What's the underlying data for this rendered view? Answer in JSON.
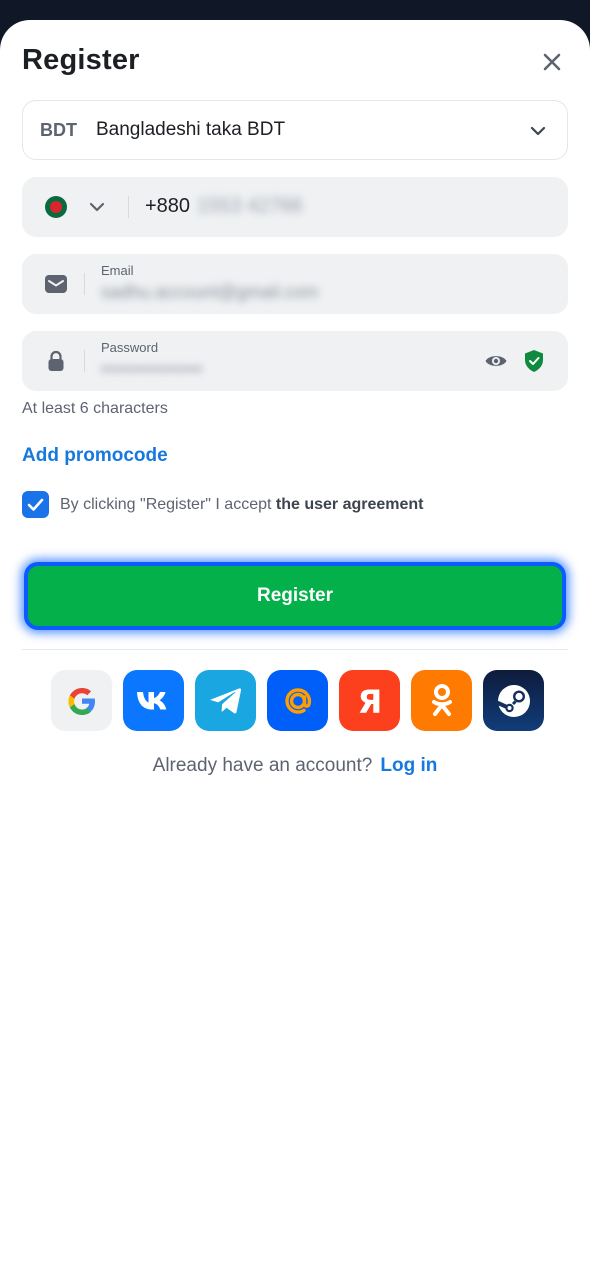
{
  "header": {
    "title": "Register"
  },
  "currency": {
    "code": "BDT",
    "name": "Bangladeshi taka BDT"
  },
  "phone": {
    "prefix": "+880",
    "number": "1553 42766"
  },
  "email": {
    "label": "Email",
    "value": "sadhu.account@gmail.com"
  },
  "password": {
    "label": "Password",
    "value": "••••••••••••••"
  },
  "hint": "At least 6 characters",
  "promo": "Add promocode",
  "agreement": {
    "checked": true,
    "text": "By clicking \"Register\" I accept ",
    "link": "the user agreement"
  },
  "register_button": "Register",
  "socials": [
    "google-icon",
    "vk-icon",
    "telegram-icon",
    "mail-ru-icon",
    "yandex-icon",
    "odnoklassniki-icon",
    "steam-icon"
  ],
  "login": {
    "text": "Already have an account?",
    "link": "Log in"
  },
  "colors": {
    "primary": "#04b04a",
    "link": "#1778e0",
    "checkbox": "#1a73e8"
  }
}
